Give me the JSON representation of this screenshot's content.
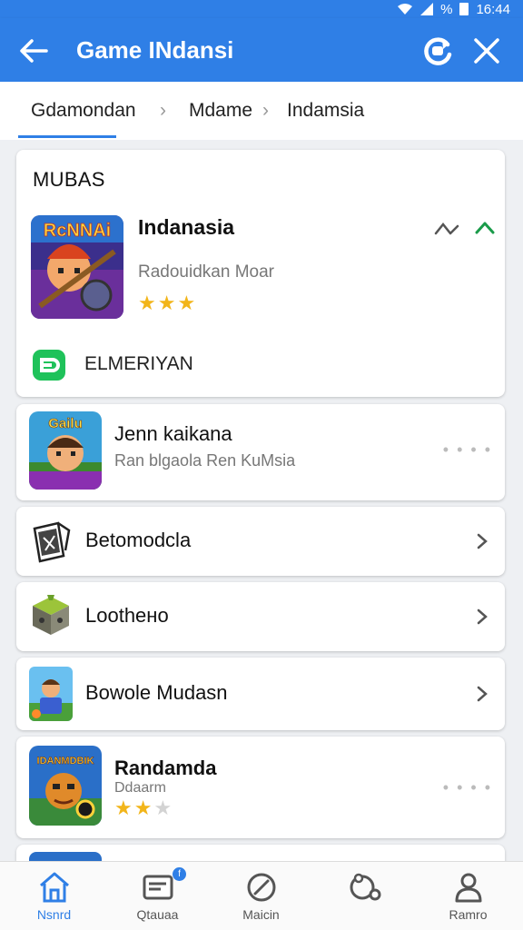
{
  "status_bar": {
    "battery_pct": "%",
    "time": "16:44"
  },
  "app_bar": {
    "title": "Game INdansi"
  },
  "breadcrumb": [
    "Gdamondan",
    "Mdame",
    "Indamsia"
  ],
  "featured": {
    "section_title": "MUBAS",
    "game": {
      "title": "Indanasia",
      "subtitle": "Radouidkan Moar",
      "rating": 3,
      "rating_max": 3,
      "icon_text": "RcNNAi"
    },
    "badge_label": "ELMERIYAN"
  },
  "list": [
    {
      "title": "Jenn kaikana",
      "subtitle": "Ran blgaola Ren KuMsia",
      "icon_text": "Gailu"
    },
    {
      "title": "Betomodcla"
    },
    {
      "title": "Loothено"
    },
    {
      "title": "Bowole Mudasn"
    },
    {
      "title": "Randamda",
      "subtitle": "Ddaarm",
      "rating": 2,
      "rating_max": 3,
      "icon_text": "IDANMDBIK"
    }
  ],
  "bottom_nav": [
    {
      "label": "Nsnrd",
      "icon": "home-icon",
      "active": true
    },
    {
      "label": "Qtauaa",
      "icon": "inbox-icon",
      "badge": "f"
    },
    {
      "label": "Maicin",
      "icon": "compass-icon"
    },
    {
      "label": "",
      "icon": "headset-icon"
    },
    {
      "label": "Ramro",
      "icon": "profile-icon"
    }
  ],
  "colors": {
    "primary": "#2f7fe6",
    "accent_green": "#1fc25a",
    "star": "#f2b51a",
    "background": "#eef0f3"
  }
}
